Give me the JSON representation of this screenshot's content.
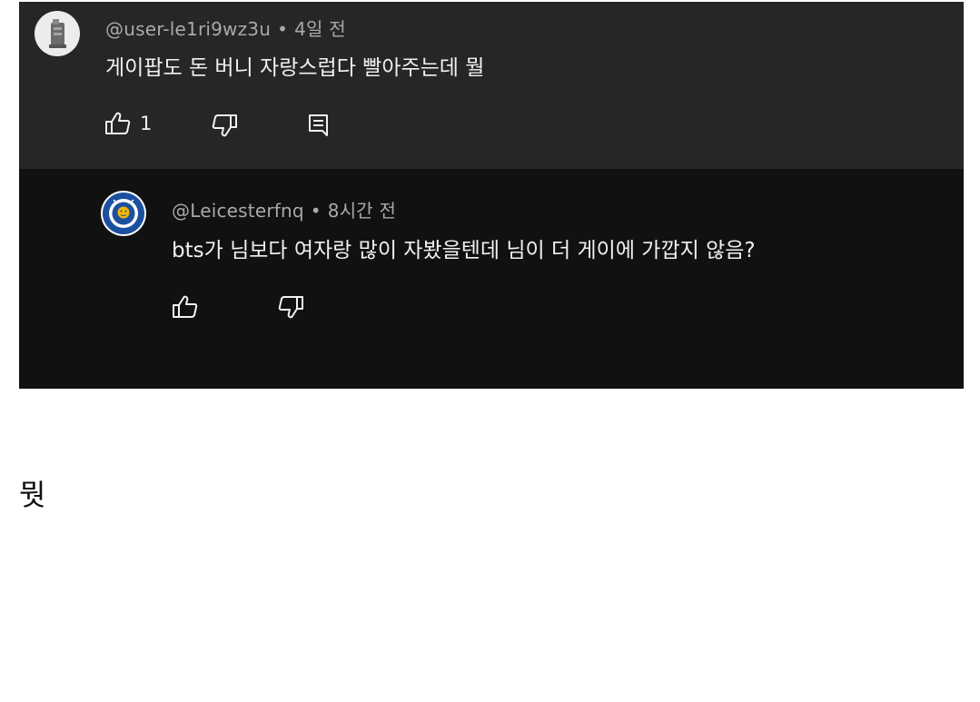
{
  "comment": {
    "author": "@user-le1ri9wz3u",
    "time": "4일 전",
    "text": "게이팝도 돈 버니 자랑스럽다 빨아주는데 뭘",
    "like_count": "1"
  },
  "reply": {
    "author": "@Leicesterfnq",
    "time": "8시간 전",
    "text": "bts가 님보다 여자랑 많이 자봤을텐데 님이 더 게이에 가깝지 않음?"
  },
  "separator": "•",
  "caption": "뭣",
  "icons": {
    "like": "thumbs-up-icon",
    "dislike": "thumbs-down-icon",
    "reply": "reply-comment-icon"
  },
  "colors": {
    "comment_bg": "#262626",
    "reply_bg": "#111111",
    "meta_text": "#a9a9a9",
    "body_text": "#f1f1f1",
    "lcfc_blue": "#1b4fa0"
  }
}
